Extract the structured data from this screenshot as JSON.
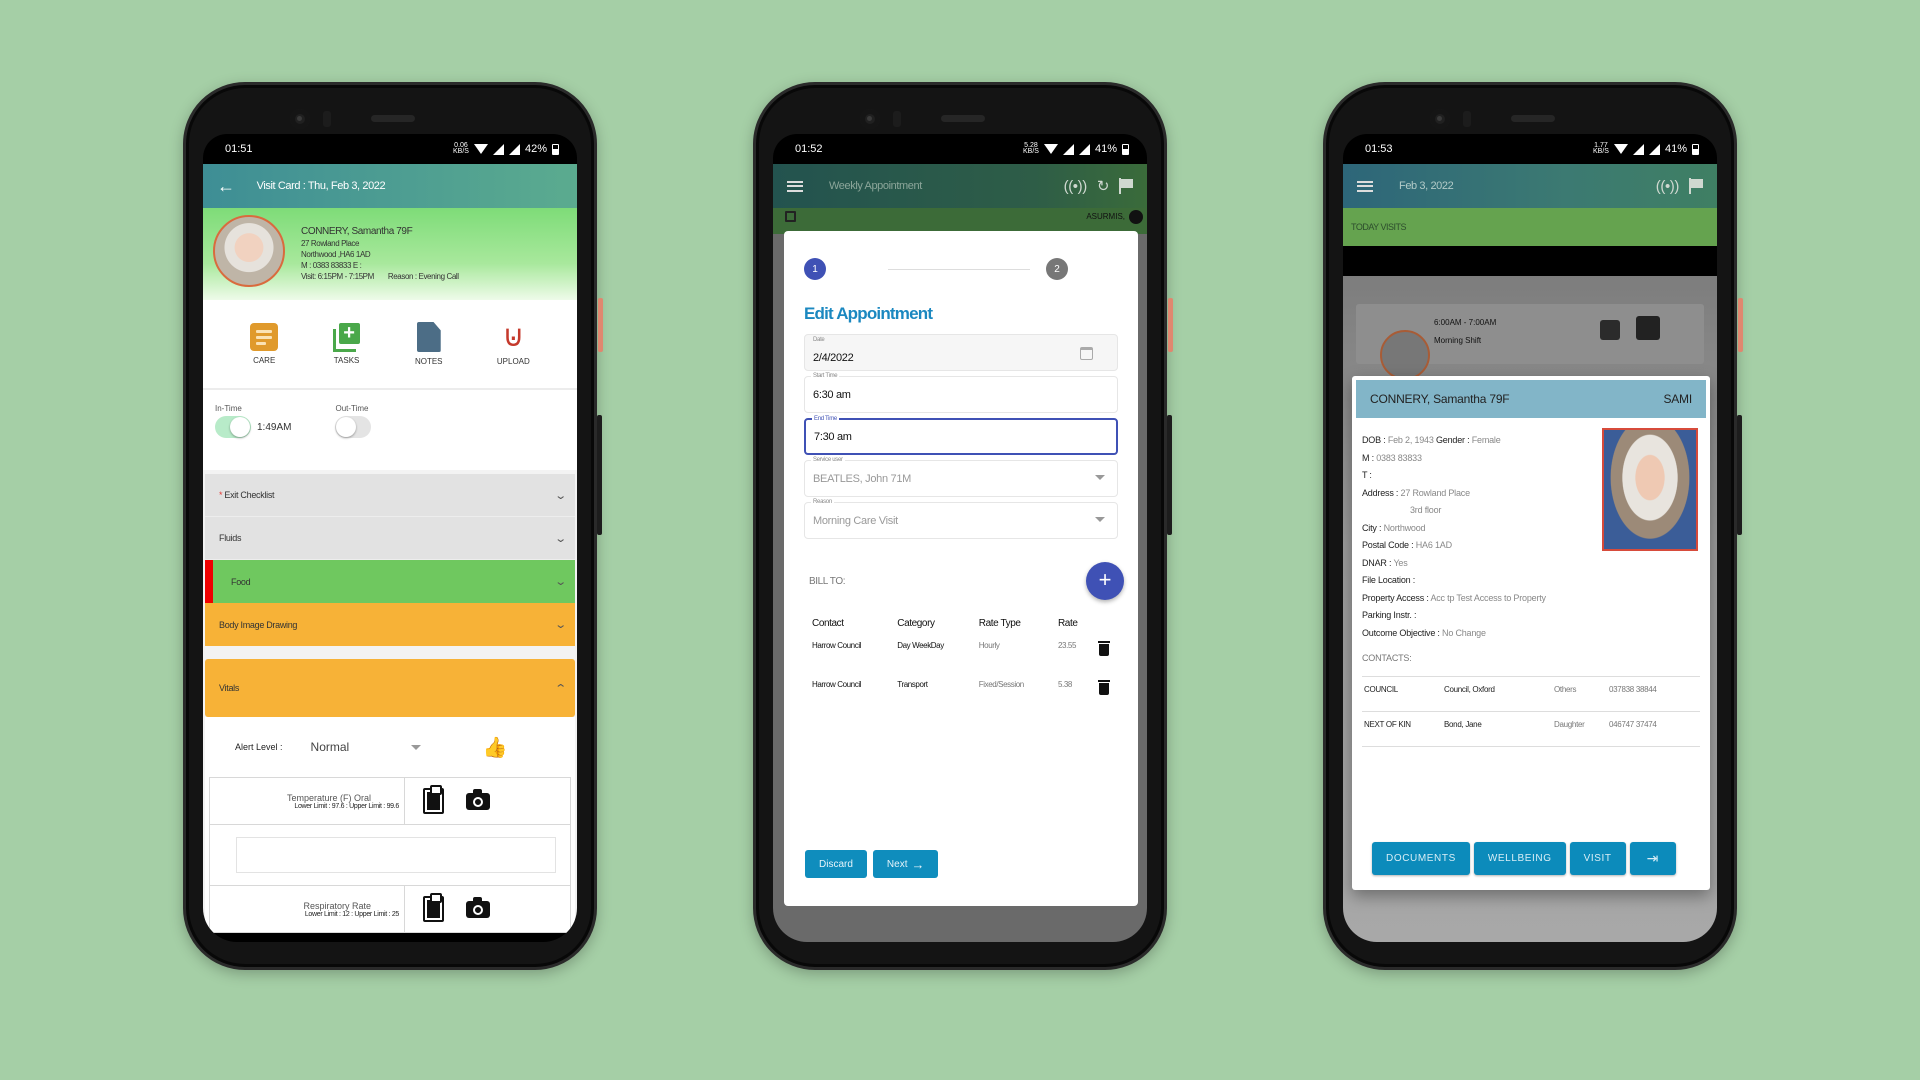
{
  "phones": [
    {
      "status": {
        "time": "01:51",
        "speed": "0.06",
        "speed_unit": "KB/S",
        "battery": "42%"
      },
      "appbar": {
        "title": "Visit Card : Thu, Feb 3, 2022",
        "back_icon": "arrow-left-icon"
      },
      "client": {
        "name": "CONNERY, Samantha 79F",
        "address1": "27 Rowland Place",
        "address2": "Northwood ,HA6 1AD",
        "contact": "M : 0383 83833 E :",
        "visit": "Visit:  6:15PM - 7:15PM",
        "reason": "Reason : Evening Call"
      },
      "actions": [
        {
          "label": "CARE",
          "icon": "care-list-icon"
        },
        {
          "label": "TASKS",
          "icon": "add-task-icon"
        },
        {
          "label": "NOTES",
          "icon": "note-icon"
        },
        {
          "label": "UPLOAD",
          "icon": "paperclip-icon"
        }
      ],
      "in_time": {
        "label": "In-Time",
        "value": "1:49AM",
        "on": true
      },
      "out_time": {
        "label": "Out-Time",
        "on": false
      },
      "sections": [
        {
          "label": "Exit Checklist",
          "required_mark": "*",
          "style": "grey",
          "chevron": "⌄"
        },
        {
          "label": "Fluids",
          "style": "grey",
          "chevron": "⌄"
        },
        {
          "label": "Food",
          "style": "green",
          "chevron": "⌄"
        },
        {
          "label": "Body Image Drawing",
          "style": "orange",
          "chevron": "⌄"
        }
      ],
      "vitals": {
        "label": "Vitals",
        "chevron": "⌃",
        "alert_label": "Alert Level :",
        "alert_value": "Normal",
        "thumb_icon": "👍",
        "items": [
          {
            "name": "Temperature (F) Oral",
            "limits": "Lower Limit : 97.6 : Upper Limit : 99.6"
          },
          {
            "name": "Respiratory Rate",
            "limits": "Lower Limit : 12 : Upper Limit : 25"
          }
        ]
      },
      "colors": {
        "food_flag": "#f00000",
        "food_bg": "#6fc85f",
        "orange": "#f7b237",
        "grey": "#e2e2e2"
      }
    },
    {
      "status": {
        "time": "01:52",
        "speed": "5.28",
        "speed_unit": "KB/S",
        "battery": "41%"
      },
      "appbar": {
        "title": "Weekly Appointment",
        "icons": [
          "broadcast-icon",
          "history-icon",
          "flag-icon"
        ]
      },
      "background": {
        "user": "ASURMIS,"
      },
      "modal": {
        "steps": [
          "1",
          "2"
        ],
        "active_step": 1,
        "title": "Edit Appointment",
        "fields": {
          "date": {
            "label": "Date",
            "value": "2/4/2022"
          },
          "start": {
            "label": "Start Time",
            "value": "6:30 am"
          },
          "end": {
            "label": "End Time",
            "value": "7:30 am"
          },
          "service_user": {
            "label": "Service user",
            "value": "BEATLES, John 71M"
          },
          "reason": {
            "label": "Reason",
            "value": "Morning Care Visit"
          }
        },
        "bill_to_label": "BILL TO:",
        "add_icon": "+",
        "table": {
          "headers": [
            "Contact",
            "Category",
            "Rate Type",
            "Rate"
          ],
          "rows": [
            [
              "Harrow Council",
              "Day WeekDay",
              "Hourly",
              "23.55"
            ],
            [
              "Harrow Council",
              "Transport",
              "Fixed/Session",
              "5.38"
            ]
          ]
        },
        "discard_label": "Discard",
        "next_label": "Next",
        "next_icon": "→"
      },
      "colors": {
        "primary": "#3f51b5",
        "title": "#1b88c0",
        "button": "#0f8dbd"
      }
    },
    {
      "status": {
        "time": "01:53",
        "speed": "1.77",
        "speed_unit": "KB/S",
        "battery": "41%"
      },
      "appbar": {
        "title": "Feb 3, 2022",
        "icons": [
          "broadcast-icon",
          "flag-icon"
        ]
      },
      "today_label": "TODAY VISITS",
      "visit_card": {
        "time": "6:00AM - 7:00AM",
        "shift": "Morning Shift"
      },
      "detail": {
        "name": "CONNERY, Samantha 79F",
        "code": "SAMI",
        "fields": [
          {
            "k": "DOB :",
            "v": "Feb 2, 1943",
            "k2": "Gender :",
            "v2": "Female"
          },
          {
            "k": "M :",
            "v": "0383 83833"
          },
          {
            "k": "T :",
            "v": ""
          },
          {
            "k": "Address :",
            "v": "27 Rowland Place"
          },
          {
            "k": "",
            "v": "3rd floor",
            "indent": true
          },
          {
            "k": "City :",
            "v": "Northwood"
          },
          {
            "k": "Postal Code :",
            "v": "HA6 1AD"
          },
          {
            "k": "DNAR :",
            "v": "Yes"
          },
          {
            "k": "File Location :",
            "v": ""
          },
          {
            "k": "Property Access :",
            "v": "Acc tp Test Access to Property"
          },
          {
            "k": "Parking Instr. :",
            "v": ""
          },
          {
            "k": "Outcome Objective :",
            "v": "No Change"
          }
        ],
        "contacts_label": "CONTACTS:",
        "contacts": [
          [
            "COUNCIL",
            "Council, Oxford",
            "Others",
            "037838 38844"
          ],
          [
            "NEXT OF KIN",
            "Bond, Jane",
            "Daughter",
            "046747 37474"
          ]
        ],
        "buttons": [
          "DOCUMENTS",
          "WELLBEING",
          "VISIT"
        ],
        "exit_icon": "⇥"
      },
      "colors": {
        "header": "#82b5c8",
        "button": "#0c8bbb",
        "today_bar": "#65a34f"
      }
    }
  ]
}
